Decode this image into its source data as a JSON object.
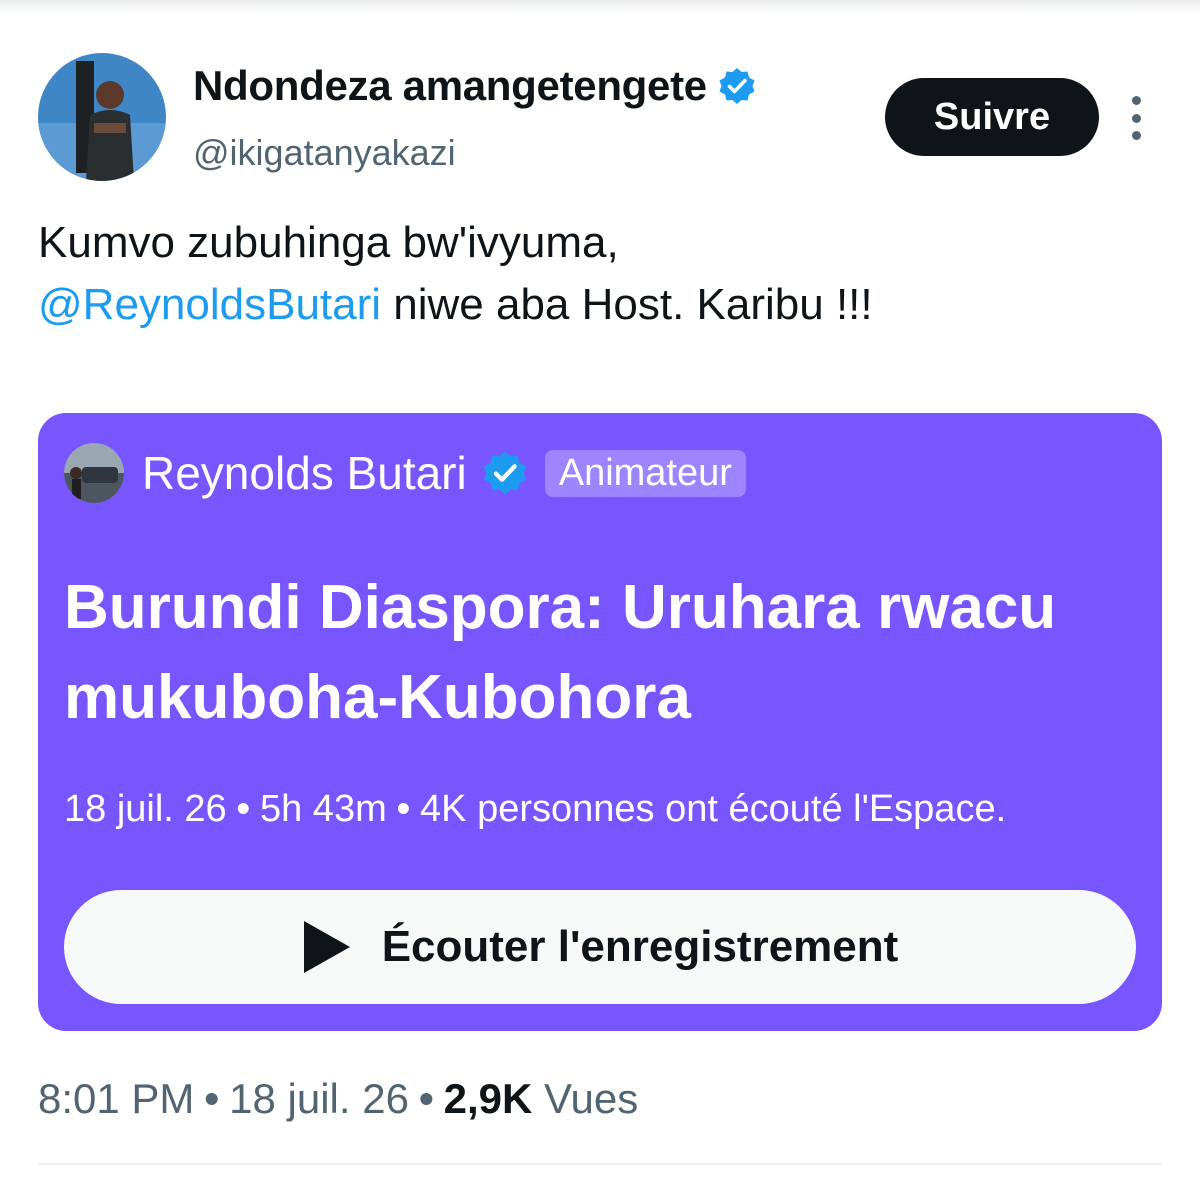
{
  "colors": {
    "space_purple": "#7856ff",
    "mention_blue": "#1d9bf0",
    "verified_blue": "#1d9bf0",
    "text_primary": "#0f1419",
    "text_secondary": "#536471"
  },
  "author": {
    "display_name": "Ndondeza amangetengete",
    "handle": "@ikigatanyakazi",
    "verified_icon": "verified-badge-icon"
  },
  "actions": {
    "follow_label": "Suivre",
    "more_icon": "more-vertical-icon"
  },
  "tweet": {
    "text_line1": "Kumvo zubuhinga bw'ivyuma,",
    "mention": "@ReynoldsButari",
    "text_rest": " niwe aba Host. Karibu !!!"
  },
  "space_card": {
    "host_name": "Reynolds Butari",
    "host_role": "Animateur",
    "title": "Burundi Diaspora: Uruhara rwacu mukuboha-Kubohora",
    "date": "18 juil. 26",
    "duration": "5h 43m",
    "listeners": "4K personnes ont écouté l'Espace.",
    "play_label": "Écouter l'enregistrement",
    "play_icon": "play-icon"
  },
  "meta": {
    "time": "8:01 PM",
    "date": "18 juil. 26",
    "views_count": "2,9K",
    "views_label": "Vues"
  }
}
